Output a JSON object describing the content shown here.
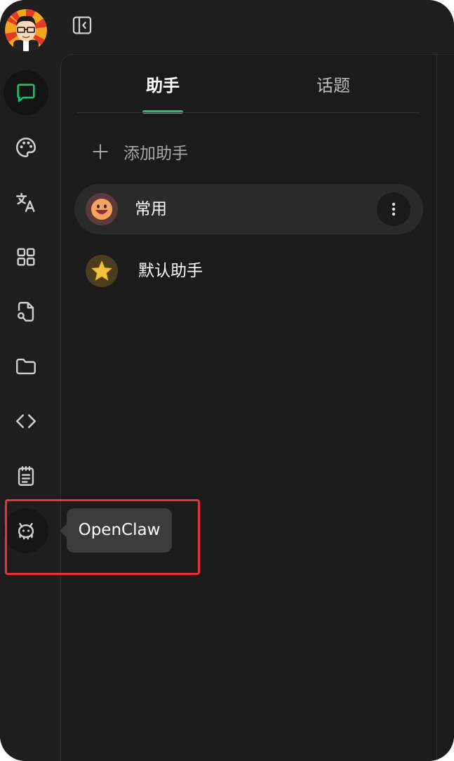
{
  "sidebar": {
    "avatar": {
      "alt": "user-avatar"
    },
    "items": [
      {
        "name": "chat-icon",
        "active": true
      },
      {
        "name": "palette-icon"
      },
      {
        "name": "translate-icon"
      },
      {
        "name": "apps-grid-icon"
      },
      {
        "name": "file-search-icon"
      },
      {
        "name": "folder-icon"
      },
      {
        "name": "code-icon"
      },
      {
        "name": "notes-icon"
      },
      {
        "name": "openclaw-icon",
        "hovered": true
      }
    ],
    "tooltip": "OpenClaw"
  },
  "header": {
    "toggle_icon": "sidebar-collapse-icon"
  },
  "tabs": {
    "assistants": "助手",
    "topics": "话题"
  },
  "add_assistant_label": "添加助手",
  "assistants": [
    {
      "label": "常用",
      "icon": "grinning-face-emoji",
      "selected": true
    },
    {
      "label": "默认助手",
      "icon": "star-emoji",
      "selected": false
    }
  ],
  "colors": {
    "accent": "#1fbf75",
    "highlight": "#e8323a"
  }
}
